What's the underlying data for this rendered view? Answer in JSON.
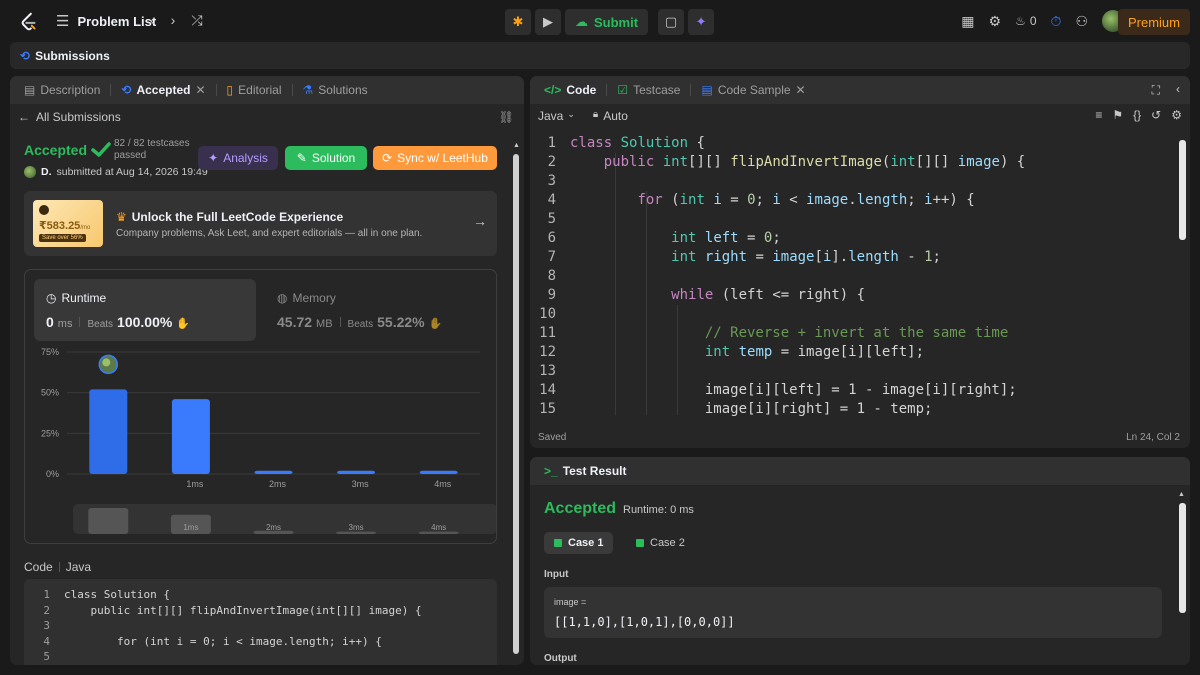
{
  "topnav": {
    "problem_list": "Problem List",
    "submit_label": "Submit",
    "streak_count": "0",
    "premium_label": "Premium"
  },
  "submissions_bar": {
    "label": "Submissions"
  },
  "left_tabs": [
    {
      "label": "Description"
    },
    {
      "label": "Accepted"
    },
    {
      "label": "Editorial"
    },
    {
      "label": "Solutions"
    }
  ],
  "submission": {
    "all_submissions": "All Submissions",
    "status": "Accepted",
    "testcases": "82 / 82 testcases passed",
    "user": "D.",
    "submitted_at": "submitted at Aug 14, 2026 19:49",
    "analysis_label": "Analysis",
    "solution_label": "Solution",
    "sync_label": "Sync w/ LeetHub"
  },
  "promo": {
    "price": "₹583.25",
    "price_unit": "/mo",
    "save_badge": "Save over 56%",
    "title": "Unlock the Full LeetCode Experience",
    "subtitle": "Company problems, Ask Leet, and expert editorials — all in one plan."
  },
  "stats": {
    "runtime_label": "Runtime",
    "runtime_value": "0",
    "runtime_unit": "ms",
    "runtime_beats_label": "Beats",
    "runtime_beats": "100.00%",
    "memory_label": "Memory",
    "memory_value": "45.72",
    "memory_unit": "MB",
    "memory_beats_label": "Beats",
    "memory_beats": "55.22%"
  },
  "chart_data": {
    "type": "bar",
    "categories": [
      "",
      "1ms",
      "2ms",
      "3ms",
      "4ms"
    ],
    "values": [
      52,
      46,
      2,
      2,
      2
    ],
    "yticks": [
      "75%",
      "50%",
      "25%",
      "0%"
    ],
    "ytick_values": [
      75,
      50,
      25,
      0
    ],
    "ylim": [
      0,
      75
    ],
    "highlight_index": 0,
    "mini_values": [
      65,
      48,
      8,
      6,
      6
    ],
    "colors": {
      "bar": "#3a7bfd",
      "highlight": "#2f6ce8"
    }
  },
  "mini_code": {
    "label": "Code",
    "lang": "Java",
    "lines": [
      {
        "n": "1",
        "text": "class Solution {"
      },
      {
        "n": "2",
        "text": "    public int[][] flipAndInvertImage(int[][] image) {"
      },
      {
        "n": "3",
        "text": ""
      },
      {
        "n": "4",
        "text": "        for (int i = 0; i < image.length; i++) {"
      },
      {
        "n": "5",
        "text": ""
      }
    ]
  },
  "right_tabs": [
    {
      "label": "Code"
    },
    {
      "label": "Testcase"
    },
    {
      "label": "Code Sample"
    }
  ],
  "editor": {
    "language": "Java",
    "mode": "Auto",
    "saved": "Saved",
    "cursor": "Ln 24, Col 2",
    "line_numbers": [
      "1",
      "2",
      "3",
      "4",
      "5",
      "6",
      "7",
      "8",
      "9",
      "10",
      "11",
      "12",
      "13",
      "14",
      "15"
    ]
  },
  "test_result": {
    "header": "Test Result",
    "status": "Accepted",
    "runtime": "Runtime: 0 ms",
    "case1": "Case 1",
    "case2": "Case 2",
    "input_label": "Input",
    "input_name": "image =",
    "input_value": "[[1,1,0],[1,0,1],[0,0,0]]",
    "output_label": "Output"
  }
}
